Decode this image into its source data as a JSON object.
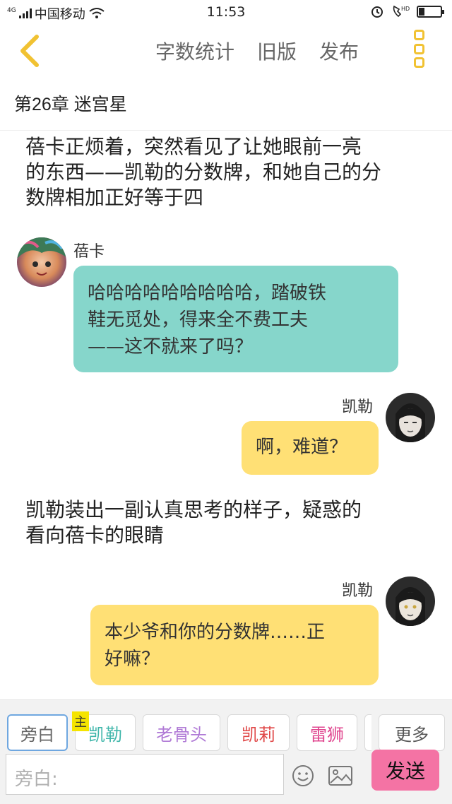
{
  "status_bar": {
    "network": "4G",
    "carrier": "中国移动",
    "time": "11:53",
    "battery_level": 0.25
  },
  "nav": {
    "actions": [
      "字数统计",
      "旧版",
      "发布"
    ],
    "accent_color": "#f1c232"
  },
  "chapter_title": "第26章 迷宫星",
  "messages": {
    "narration_1": [
      "蓓卡正烦着，突然看见了让她眼前一亮",
      "的东西——凯勒的分数牌，和她自己的分",
      "数牌相加正好等于四"
    ],
    "msg1_name": "蓓卡",
    "msg1_text": [
      "哈哈哈哈哈哈哈哈哈，踏破铁",
      "鞋无觅处，得来全不费工夫",
      "——这不就来了吗？"
    ],
    "msg2_name": "凯勒",
    "msg2_text": "啊，难道？",
    "narration_2": [
      "凯勒装出一副认真思考的样子，疑惑的",
      "看向蓓卡的眼睛"
    ],
    "msg3_name": "凯勒",
    "msg3_text": [
      "本少爷和你的分数牌……正",
      "好嘛？"
    ]
  },
  "toolbar": {
    "main_tag": "主",
    "roles": [
      {
        "label": "旁白",
        "color": "#666666"
      },
      {
        "label": "凯勒",
        "color": "#3fb6aa"
      },
      {
        "label": "老骨头",
        "color": "#b07ad6"
      },
      {
        "label": "凯莉",
        "color": "#e04848"
      },
      {
        "label": "雷狮",
        "color": "#e0468f"
      }
    ],
    "more_label": "更多",
    "input_placeholder": "旁白:",
    "send_label": "发送"
  }
}
